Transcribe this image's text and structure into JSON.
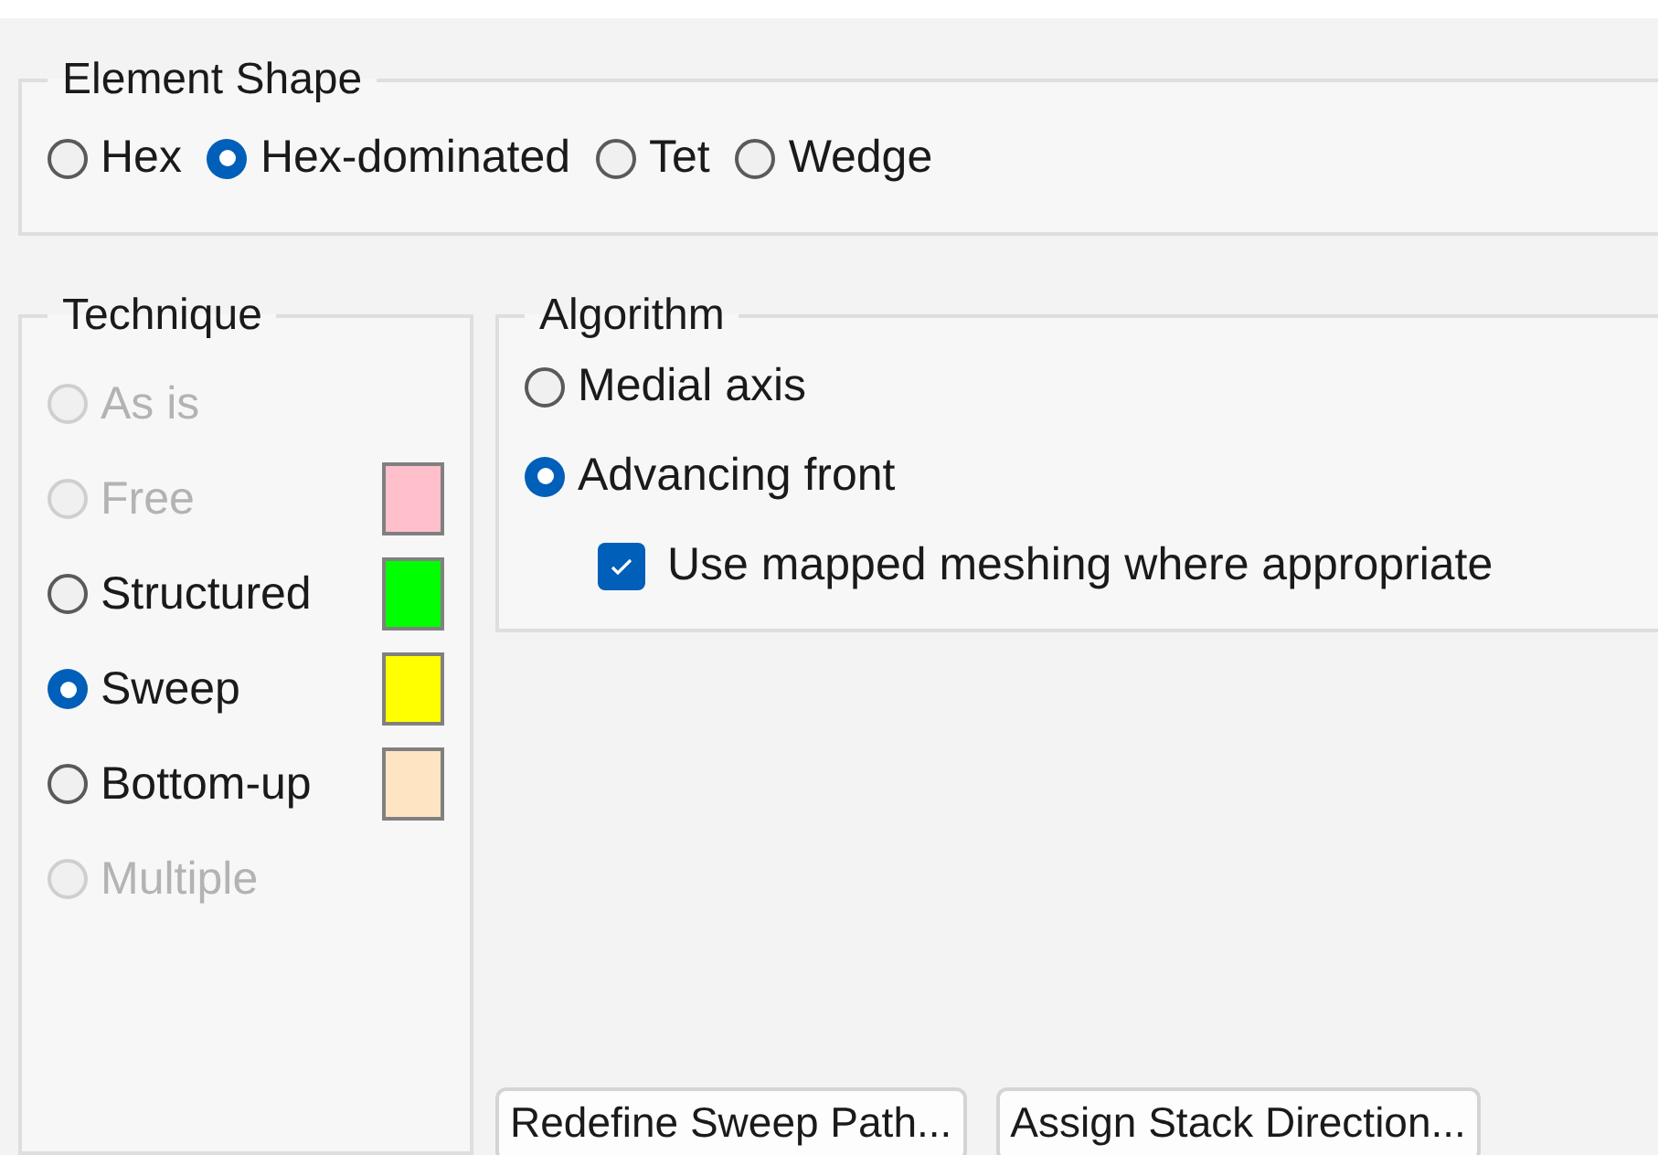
{
  "element_shape": {
    "title": "Element Shape",
    "options": [
      {
        "label": "Hex",
        "selected": false
      },
      {
        "label": "Hex-dominated",
        "selected": true
      },
      {
        "label": "Tet",
        "selected": false
      },
      {
        "label": "Wedge",
        "selected": false
      }
    ]
  },
  "technique": {
    "title": "Technique",
    "options": [
      {
        "label": "As is",
        "selected": false,
        "disabled": true
      },
      {
        "label": "Free",
        "selected": false,
        "disabled": true,
        "color": "#ffc0cb"
      },
      {
        "label": "Structured",
        "selected": false,
        "disabled": false,
        "color": "#00ff00"
      },
      {
        "label": "Sweep",
        "selected": true,
        "disabled": false,
        "color": "#ffff00"
      },
      {
        "label": "Bottom-up",
        "selected": false,
        "disabled": false,
        "color": "#ffe4c4"
      },
      {
        "label": "Multiple",
        "selected": false,
        "disabled": true
      }
    ]
  },
  "algorithm": {
    "title": "Algorithm",
    "options": [
      {
        "label": "Medial axis",
        "selected": false
      },
      {
        "label": "Advancing front",
        "selected": true
      }
    ],
    "mapped_meshing": {
      "label": "Use mapped meshing where appropriate",
      "checked": true
    }
  },
  "buttons": [
    "Redefine Sweep Path...",
    "Assign Stack Direction..."
  ]
}
